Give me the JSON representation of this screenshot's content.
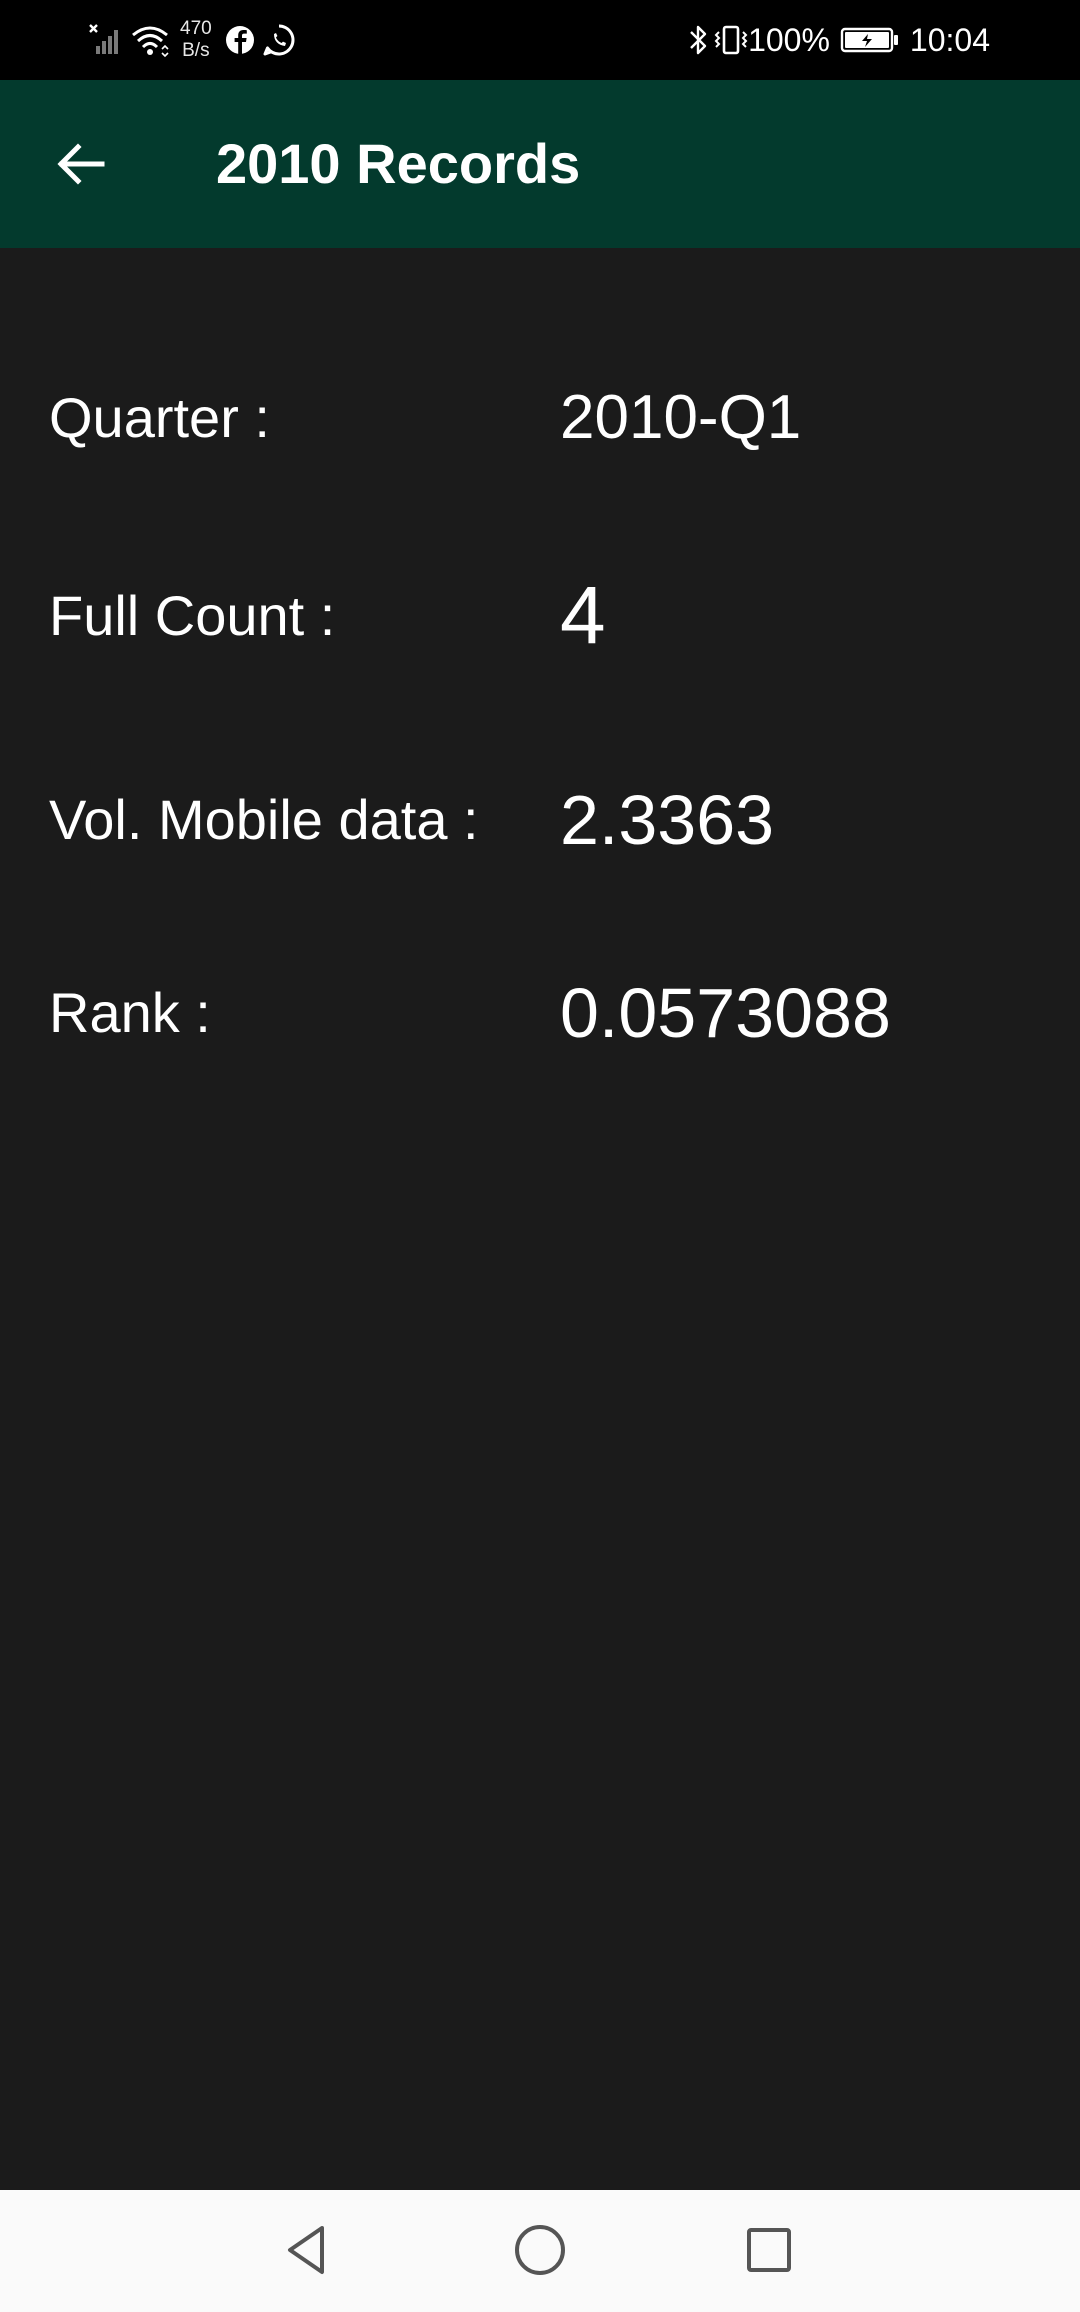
{
  "status_bar": {
    "net_speed_value": "470",
    "net_speed_unit": "B/s",
    "battery_percent": "100%",
    "time": "10:04",
    "icons": [
      "signal-off-icon",
      "wifi-icon",
      "facebook-icon",
      "whatsapp-icon",
      "bluetooth-icon",
      "vibrate-icon",
      "battery-icon"
    ]
  },
  "app_bar": {
    "title": "2010 Records",
    "back_icon": "arrow-back-icon",
    "color": "#033a2d"
  },
  "records": [
    {
      "label": "Quarter :",
      "value": "2010-Q1"
    },
    {
      "label": "Full Count :",
      "value": "4"
    },
    {
      "label": "Vol. Mobile data :",
      "value": "2.3363"
    },
    {
      "label": "Rank :",
      "value": "0.0573088"
    }
  ],
  "nav_bar": {
    "icons": [
      "back-triangle-icon",
      "home-circle-icon",
      "recents-square-icon"
    ]
  },
  "colors": {
    "background": "#1b1b1b",
    "status_bar": "#000000",
    "nav_bar": "#fafafa"
  }
}
